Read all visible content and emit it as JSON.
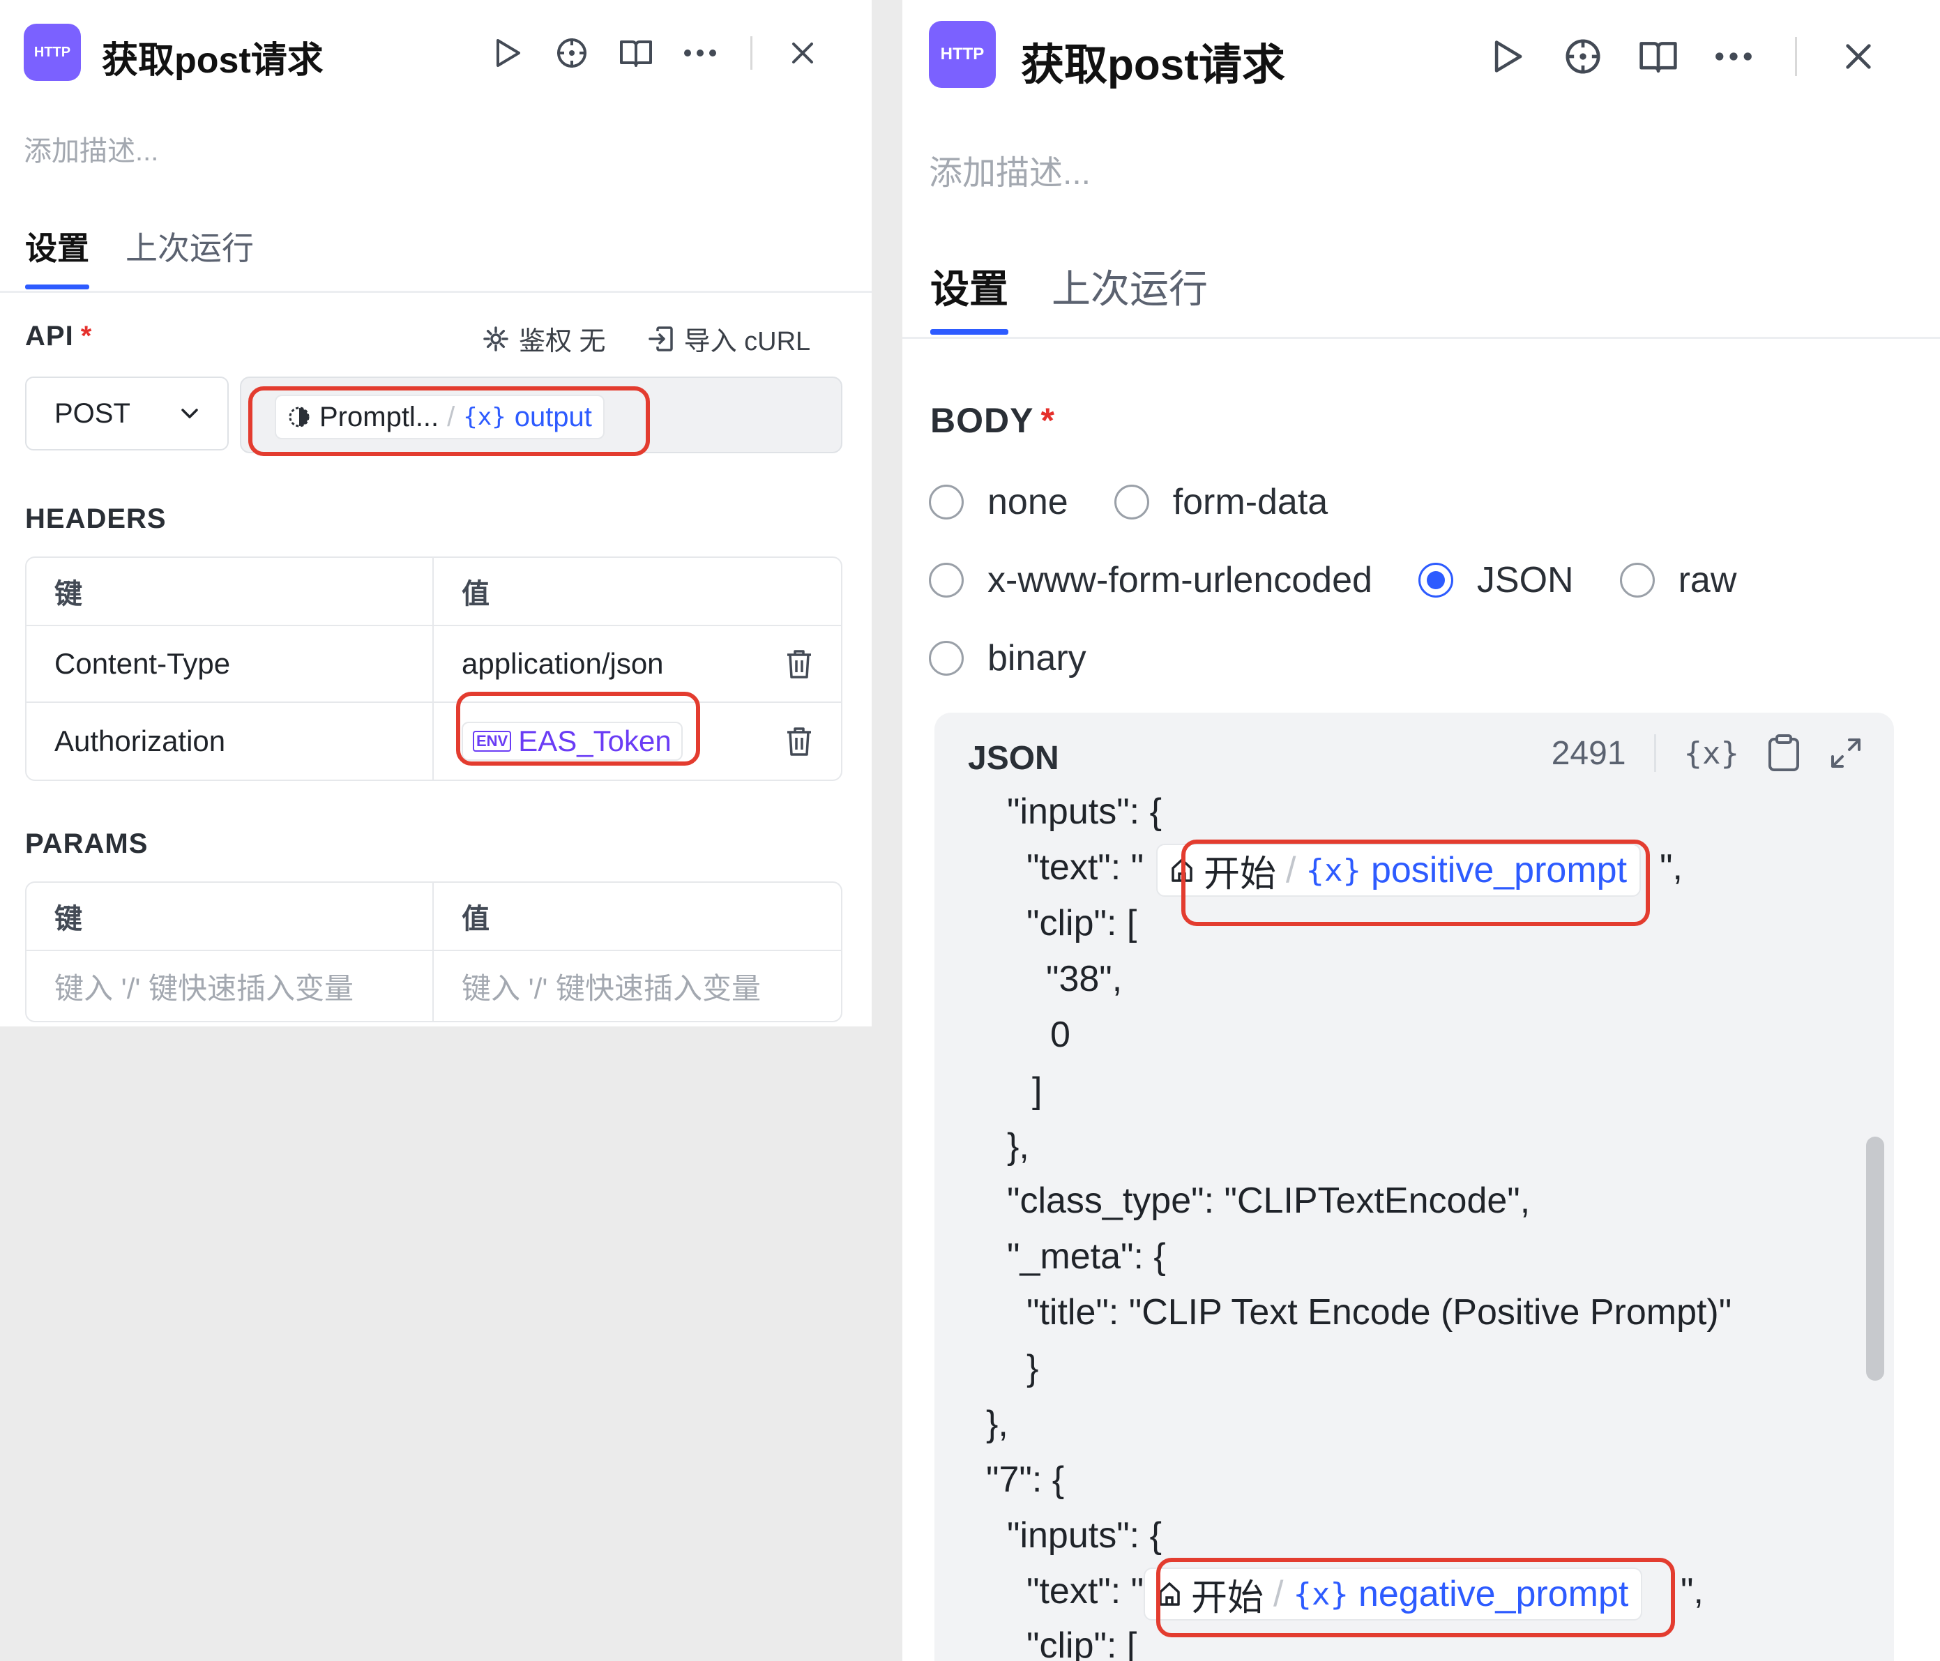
{
  "node": {
    "badge": "HTTP",
    "title": "获取post请求",
    "description_placeholder": "添加描述..."
  },
  "tabs": {
    "settings": "设置",
    "last_run": "上次运行"
  },
  "api": {
    "label": "API",
    "required_mark": "*",
    "auth_label": "鉴权 无",
    "import_label": "导入 cURL",
    "method": "POST",
    "url_source": "Promptl...",
    "url_sep": "/",
    "url_var_prefix": "{x}",
    "url_var": "output"
  },
  "headers": {
    "label": "HEADERS",
    "col_key": "键",
    "col_value": "值",
    "rows": [
      {
        "key": "Content-Type",
        "value": "application/json"
      },
      {
        "key": "Authorization",
        "env_prefix": "ENV",
        "value": "EAS_Token"
      }
    ]
  },
  "params": {
    "label": "PARAMS",
    "col_key": "键",
    "col_value": "值",
    "key_placeholder": "键入 '/' 键快速插入变量",
    "value_placeholder": "键入 '/' 键快速插入变量"
  },
  "body": {
    "label": "BODY",
    "required_mark": "*",
    "options": [
      "none",
      "form-data",
      "x-www-form-urlencoded",
      "JSON",
      "raw",
      "binary"
    ],
    "selected": "JSON"
  },
  "json_editor": {
    "label": "JSON",
    "char_count": "2491",
    "var_tool": "{x}",
    "lines": [
      "\"inputs\": {",
      "\"text\": \"",
      "\"clip\": [",
      "\"38\",",
      "0",
      "]",
      "},",
      "\"class_type\": \"CLIPTextEncode\",",
      "\"_meta\": {",
      "\"title\": \"CLIP Text Encode (Positive Prompt)\"",
      "}",
      "},",
      "\"7\": {",
      "\"inputs\": {",
      "\"text\": \"",
      "\"clip\": ["
    ],
    "text_suffix_1": "\",",
    "text_suffix_2": "\",",
    "var_chip_1": {
      "source": "开始",
      "sep": "/",
      "prefix": "{x}",
      "name": "positive_prompt"
    },
    "var_chip_2": {
      "source": "开始",
      "sep": "/",
      "prefix": "{x}",
      "name": "negative_prompt"
    }
  },
  "colors": {
    "accent": "#2d5bff",
    "badge": "#7b61ff",
    "highlight": "#e33c2f",
    "env": "#6a3cf5"
  }
}
